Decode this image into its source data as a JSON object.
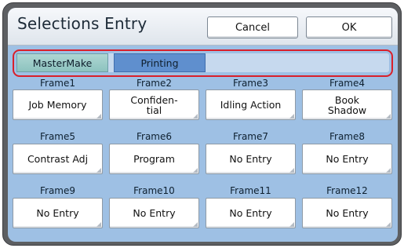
{
  "header": {
    "title": "Selections Entry",
    "cancel_label": "Cancel",
    "ok_label": "OK"
  },
  "tabs": [
    {
      "label": "MasterMake",
      "state": "normal"
    },
    {
      "label": "Printing",
      "state": "selected"
    }
  ],
  "frames": [
    {
      "label": "Frame1",
      "value": "Job Memory"
    },
    {
      "label": "Frame2",
      "value": "Confiden-\ntial"
    },
    {
      "label": "Frame3",
      "value": "Idling Action"
    },
    {
      "label": "Frame4",
      "value": "Book\nShadow"
    },
    {
      "label": "Frame5",
      "value": "Contrast Adj"
    },
    {
      "label": "Frame6",
      "value": "Program"
    },
    {
      "label": "Frame7",
      "value": "No Entry"
    },
    {
      "label": "Frame8",
      "value": "No Entry"
    },
    {
      "label": "Frame9",
      "value": "No Entry"
    },
    {
      "label": "Frame10",
      "value": "No Entry"
    },
    {
      "label": "Frame11",
      "value": "No Entry"
    },
    {
      "label": "Frame12",
      "value": "No Entry"
    }
  ],
  "colors": {
    "screen_background": "#9ec0e4",
    "highlight_frame": "#d9202a",
    "tab_selected": "#5f8fce",
    "tab_normal": "#8dc3bf"
  }
}
